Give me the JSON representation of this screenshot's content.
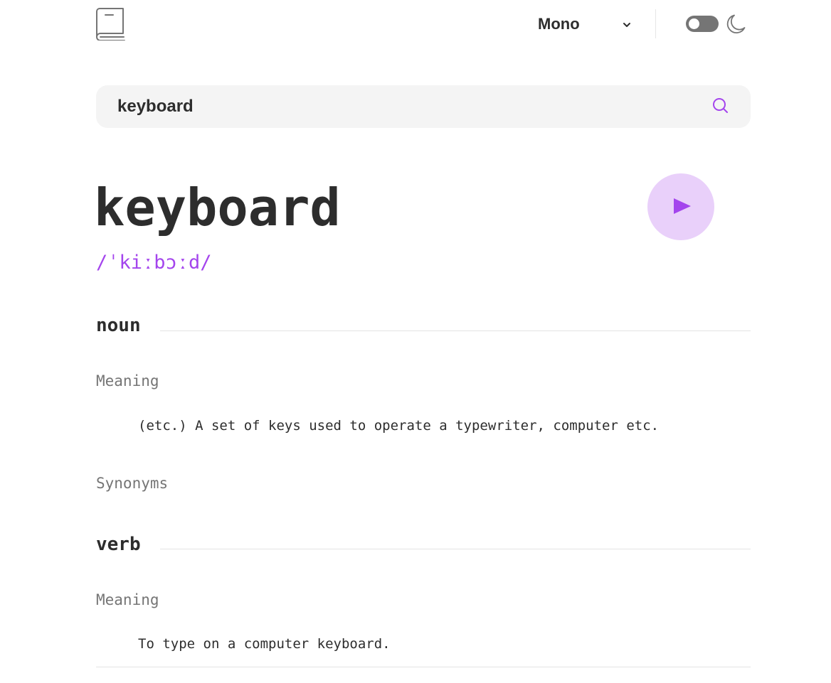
{
  "header": {
    "logo_icon": "book-icon",
    "font_selected": "Mono",
    "dropdown_icon": "chevron-down-icon",
    "theme_toggle_state": "off",
    "theme_icon": "moon-icon"
  },
  "search": {
    "value": "keyboard",
    "icon": "search-icon"
  },
  "entry": {
    "word": "keyboard",
    "phonetic": "/ˈkiːbɔːd/",
    "play_icon": "play-icon",
    "accent_color": "#a445ed",
    "meanings": [
      {
        "part_of_speech": "noun",
        "meaning_label": "Meaning",
        "definition": "(etc.) A set of keys used to operate a typewriter, computer etc.",
        "synonyms_label": "Synonyms"
      },
      {
        "part_of_speech": "verb",
        "meaning_label": "Meaning",
        "definition": "To type on a computer keyboard."
      }
    ]
  }
}
